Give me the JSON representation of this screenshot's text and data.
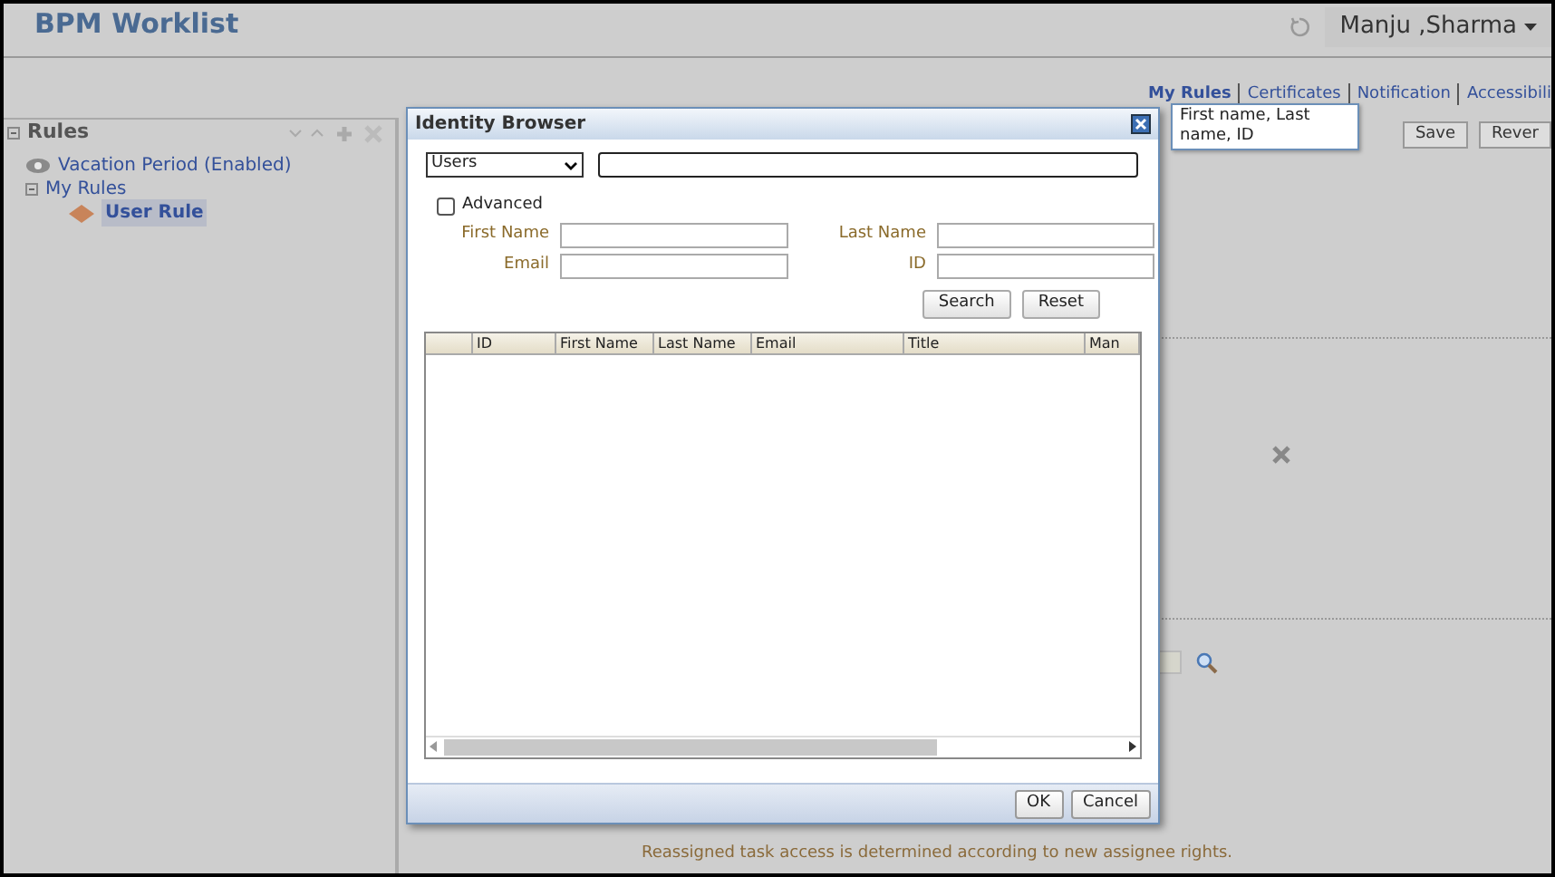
{
  "header": {
    "title": "BPM Worklist",
    "user": "Manju ,Sharma"
  },
  "tabs": [
    {
      "label": "My Rules",
      "selected": true
    },
    {
      "label": "Certificates",
      "selected": false
    },
    {
      "label": "Notification",
      "selected": false
    },
    {
      "label": "Accessibili",
      "selected": false
    }
  ],
  "rules_panel": {
    "title": "Rules",
    "expanded": true,
    "items": [
      {
        "label": "Vacation Period (Enabled)",
        "kind": "vacation",
        "selected": false
      },
      {
        "label": "My Rules",
        "kind": "folder",
        "expanded": true,
        "selected": false,
        "children": [
          {
            "label": "User Rule",
            "kind": "rule",
            "selected": true
          }
        ]
      }
    ]
  },
  "content": {
    "buttons": [
      "Save",
      "Rever"
    ],
    "message": "Reassigned task access is determined according to new assignee rights."
  },
  "dialog": {
    "title": "Identity Browser",
    "type_select": "Users",
    "tooltip": "First name, Last name, ID",
    "advanced": {
      "label": "Advanced",
      "checked": false
    },
    "fields": [
      {
        "label": "First Name"
      },
      {
        "label": "Last Name"
      },
      {
        "label": "Email"
      },
      {
        "label": "ID"
      }
    ],
    "search_buttons": [
      "Search",
      "Reset"
    ],
    "table": {
      "columns": [
        "",
        "ID",
        "First Name",
        "Last Name",
        "Email",
        "Title",
        "Man"
      ]
    },
    "footer_buttons": [
      "OK",
      "Cancel"
    ]
  }
}
